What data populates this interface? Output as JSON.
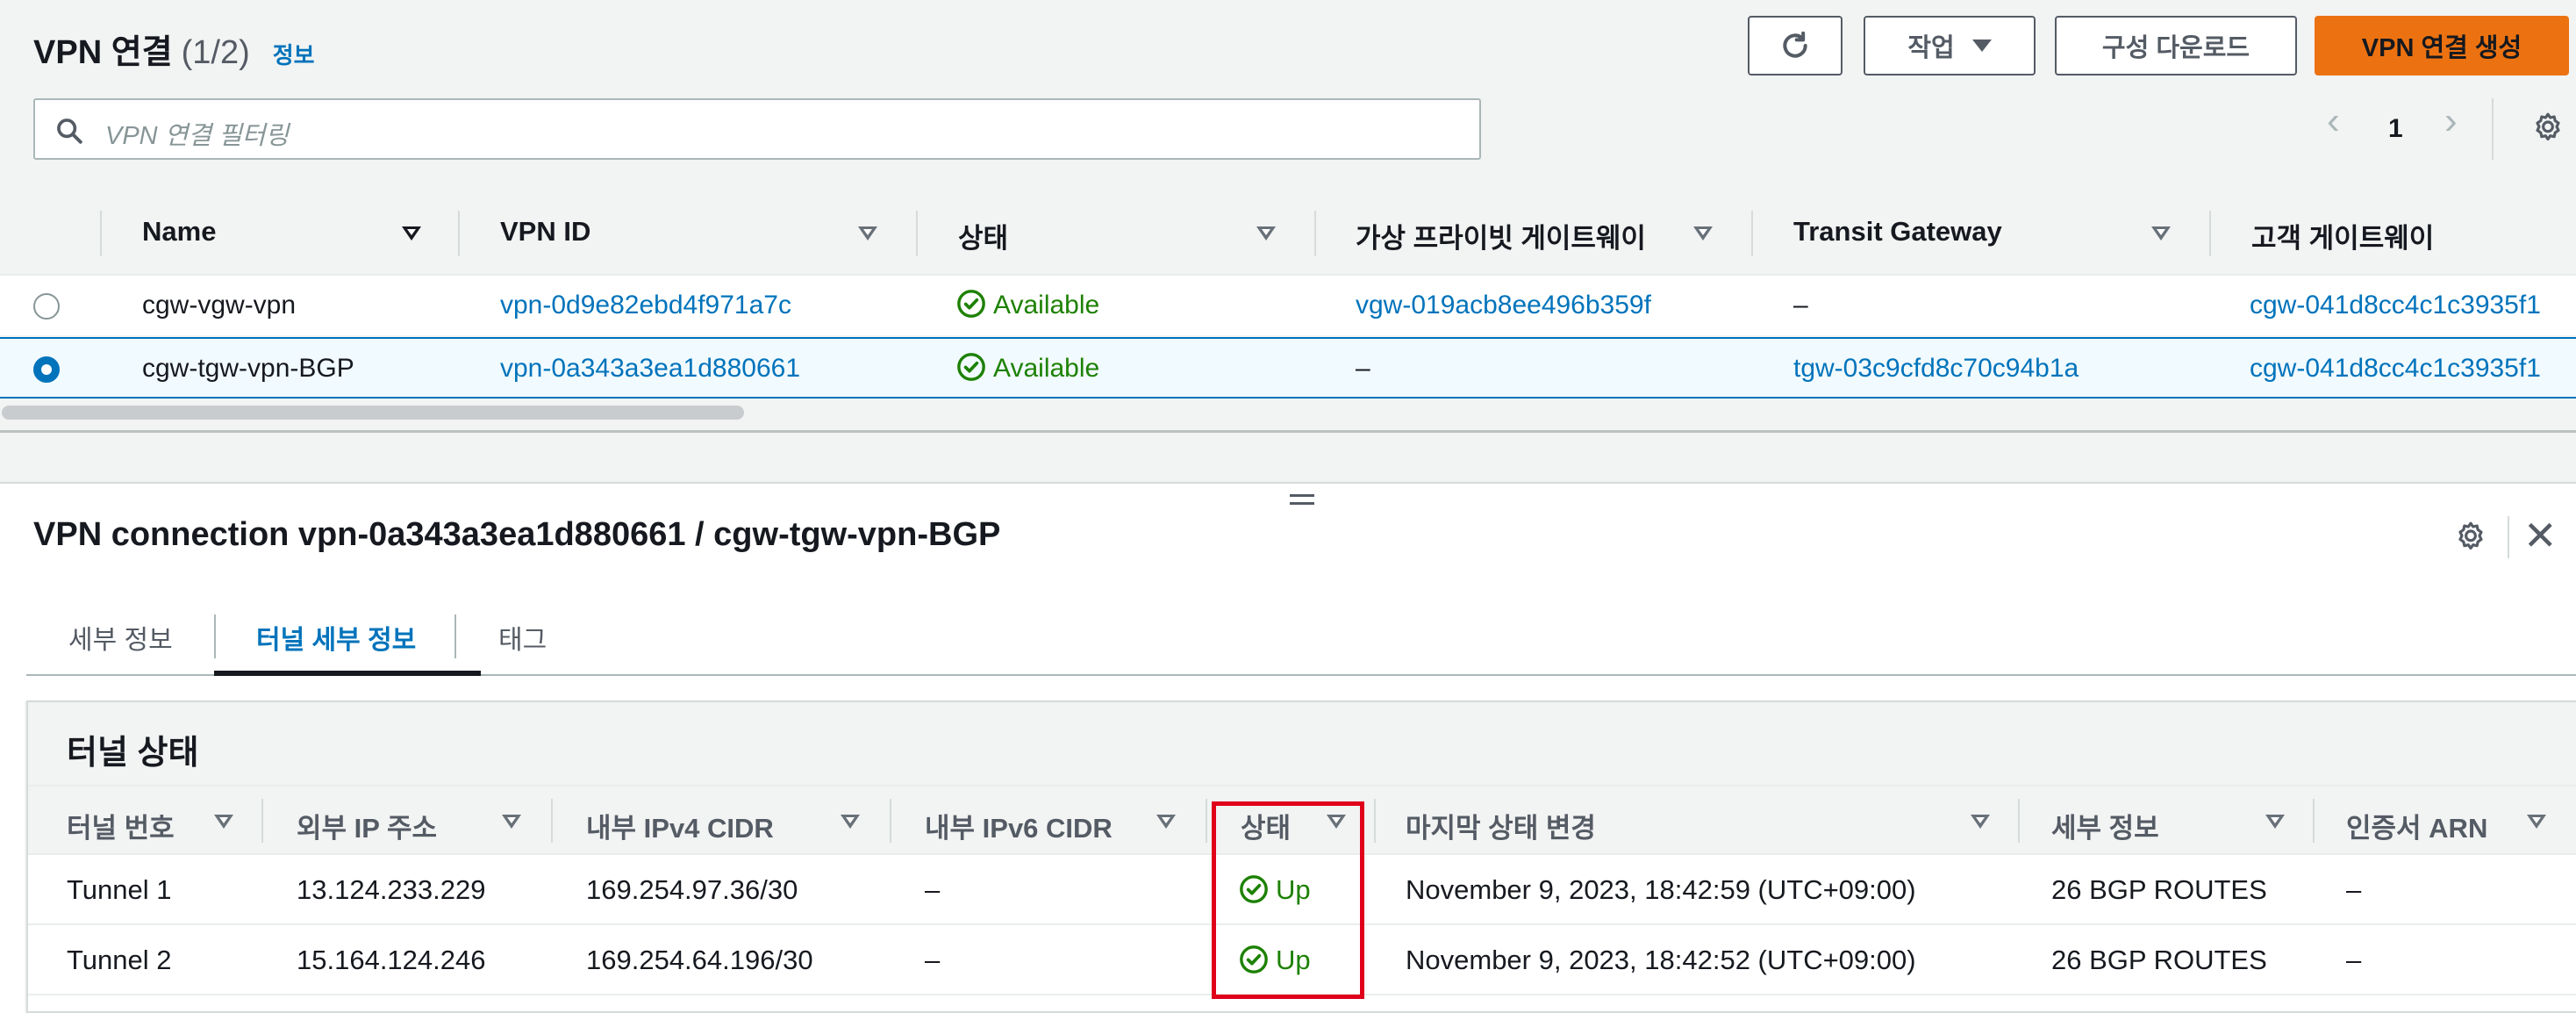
{
  "header": {
    "title": "VPN 연결",
    "count": "(1/2)",
    "info_link": "정보",
    "refresh_label": "",
    "actions_label": "작업",
    "download_label": "구성 다운로드",
    "create_label": "VPN 연결 생성"
  },
  "search": {
    "placeholder": "VPN 연결 필터링"
  },
  "pagination": {
    "page": "1"
  },
  "vpn_table": {
    "columns": [
      "Name",
      "VPN ID",
      "상태",
      "가상 프라이빗 게이트웨이",
      "Transit Gateway",
      "고객 게이트웨이"
    ],
    "rows": [
      {
        "name": "cgw-vgw-vpn",
        "vpn_id": "vpn-0d9e82ebd4f971a7c",
        "state": "Available",
        "vgw": "vgw-019acb8ee496b359f",
        "tgw": "–",
        "cgw": "cgw-041d8cc4c1c3935f1",
        "selected": false
      },
      {
        "name": "cgw-tgw-vpn-BGP",
        "vpn_id": "vpn-0a343a3ea1d880661",
        "state": "Available",
        "vgw": "–",
        "tgw": "tgw-03c9cfd8c70c94b1a",
        "cgw": "cgw-041d8cc4c1c3935f1",
        "selected": true
      }
    ]
  },
  "detail": {
    "title": "VPN connection vpn-0a343a3ea1d880661 / cgw-tgw-vpn-BGP",
    "tabs": [
      "세부 정보",
      "터널 세부 정보",
      "태그"
    ],
    "active_tab": "터널 세부 정보",
    "tunnel_section": {
      "title": "터널 상태",
      "columns": [
        "터널 번호",
        "외부 IP 주소",
        "내부 IPv4 CIDR",
        "내부 IPv6 CIDR",
        "상태",
        "마지막 상태 변경",
        "세부 정보",
        "인증서 ARN"
      ],
      "rows": [
        {
          "tunnel": "Tunnel 1",
          "outside_ip": "13.124.233.229",
          "ipv4": "169.254.97.36/30",
          "ipv6": "–",
          "status": "Up",
          "last_change": "November 9, 2023, 18:42:59 (UTC+09:00)",
          "details": "26 BGP ROUTES",
          "cert_arn": "–"
        },
        {
          "tunnel": "Tunnel 2",
          "outside_ip": "15.164.124.246",
          "ipv4": "169.254.64.196/30",
          "ipv6": "–",
          "status": "Up",
          "last_change": "November 9, 2023, 18:42:52 (UTC+09:00)",
          "details": "26 BGP ROUTES",
          "cert_arn": "–"
        }
      ]
    }
  },
  "colors": {
    "link": "#0073bb",
    "success": "#1d8102",
    "primary": "#ec7211",
    "highlight": "#e0001b"
  },
  "icons": [
    "refresh-icon",
    "caret-down-icon",
    "search-icon",
    "chevron-left-icon",
    "chevron-right-icon",
    "gear-icon",
    "sort-icon",
    "check-circle-icon",
    "close-icon",
    "drag-handle-icon"
  ]
}
